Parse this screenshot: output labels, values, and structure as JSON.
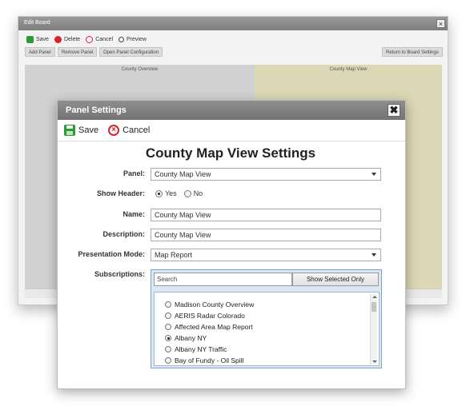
{
  "edit_board": {
    "title": "Edit Board",
    "close_glyph": "×",
    "toolbar": [
      {
        "label": "Save",
        "icon": "save-icon"
      },
      {
        "label": "Delete",
        "icon": "delete-icon"
      },
      {
        "label": "Cancel",
        "icon": "cancel-icon"
      },
      {
        "label": "Preview",
        "icon": "preview-icon"
      }
    ],
    "buttons": {
      "add_panel": "Add Panel",
      "remove_panel": "Remove Panel",
      "open_panel_config": "Open Panel Configuration",
      "return_to_settings": "Return to Board Settings"
    },
    "panels": {
      "left_title": "County Overview",
      "right_title": "County Map View"
    }
  },
  "dialog": {
    "title": "Panel Settings",
    "close_glyph": "✖",
    "toolbar": {
      "save": "Save",
      "cancel": "Cancel"
    },
    "heading": "County Map View Settings",
    "fields": {
      "panel_label": "Panel:",
      "panel_value": "County Map View",
      "show_header_label": "Show Header:",
      "show_header_yes": "Yes",
      "show_header_no": "No",
      "show_header_selected": "Yes",
      "name_label": "Name:",
      "name_value": "County Map View",
      "description_label": "Description:",
      "description_value": "County Map View",
      "presentation_label": "Presentation Mode:",
      "presentation_value": "Map Report",
      "subscriptions_label": "Subscriptions:"
    },
    "subscriptions": {
      "search_placeholder": "Search",
      "show_selected_label": "Show Selected Only",
      "items": [
        {
          "label": "Madison County Overview",
          "selected": false
        },
        {
          "label": "AERIS Radar Colorado",
          "selected": false
        },
        {
          "label": "Affected Area Map Report",
          "selected": false
        },
        {
          "label": "Albany NY",
          "selected": true
        },
        {
          "label": "Albany NY Traffic",
          "selected": false
        },
        {
          "label": "Bay of Fundy - Oil Spill",
          "selected": false
        }
      ]
    }
  },
  "colors": {
    "save_green": "#2e9a33",
    "cancel_red": "#d9232b",
    "right_panel_bg": "#dcd8b5",
    "subs_border": "#7ea3cb"
  }
}
